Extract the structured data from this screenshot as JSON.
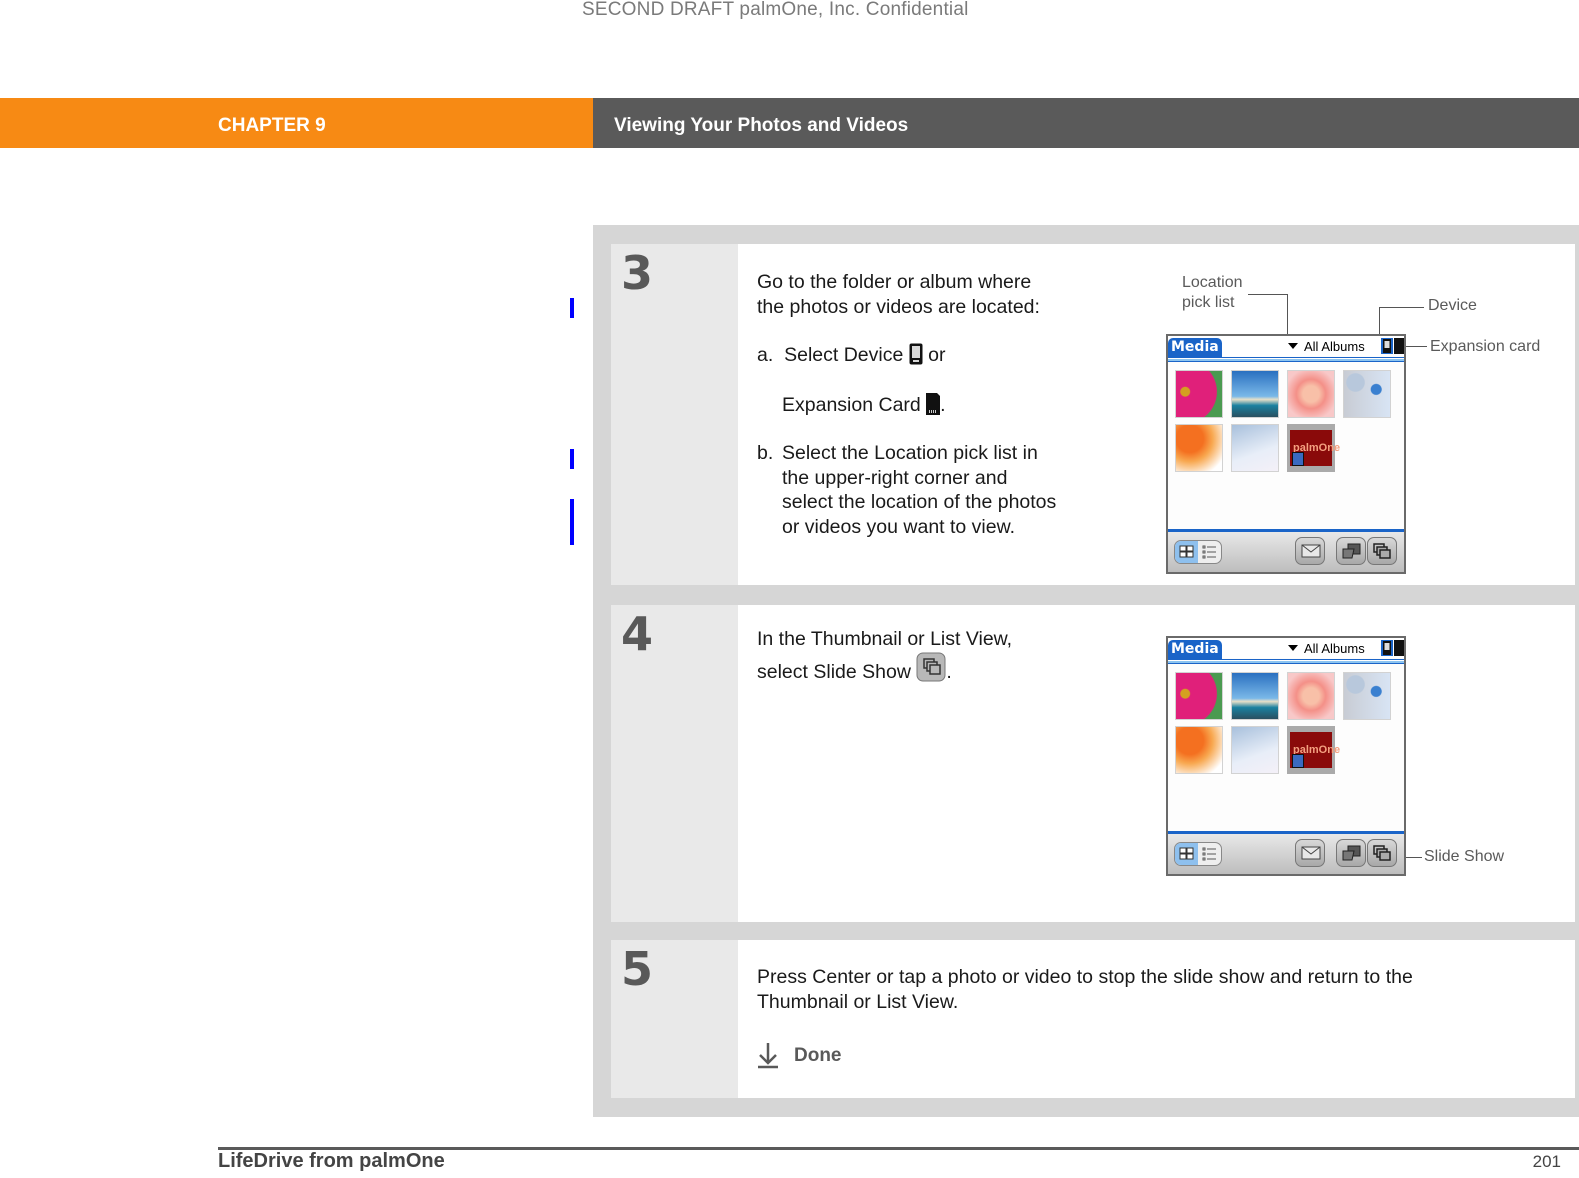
{
  "watermark": "SECOND DRAFT palmOne, Inc.  Confidential",
  "header": {
    "chapter_label": "CHAPTER 9",
    "chapter_title": "Viewing Your Photos and Videos",
    "colors": {
      "chapter_bg": "#f78a14",
      "title_bg": "#5a5a5a"
    }
  },
  "change_bar_color": "#0000ff",
  "steps": [
    {
      "number": "3",
      "intro_line1": "Go to the folder or album where",
      "intro_line2": "the photos or videos are located:",
      "item_a_label": "a.",
      "item_a_text1": "Select Device",
      "item_a_or": "or",
      "item_a_text2": "Expansion Card",
      "item_a_end": ".",
      "item_b_label": "b.",
      "item_b_lines": [
        "Select the Location pick list in",
        "the upper-right corner and",
        "select the location of the photos",
        "or videos you want to view."
      ],
      "callouts": {
        "location_line1": "Location",
        "location_line2": "pick list",
        "device": "Device",
        "expansion": "Expansion card"
      }
    },
    {
      "number": "4",
      "line1": "In the Thumbnail or List View,",
      "line2": "select Slide Show",
      "line2_end": ".",
      "callouts": {
        "slideshow": "Slide Show"
      }
    },
    {
      "number": "5",
      "line1": "Press Center or tap a photo or video to stop the slide show and return to the",
      "line2": "Thumbnail or List View.",
      "done_label": "Done"
    }
  ],
  "palm_screen": {
    "app_tab": "Media",
    "picklist_value": "All Albums",
    "thumbnails": [
      "pink-daisy",
      "palm-trees-beach",
      "pink-rose",
      "blue-bubbles",
      "orange-dots",
      "blue-swirl",
      "palmone-video"
    ],
    "video_logo": "palmOne"
  },
  "footer": {
    "book_title": "LifeDrive from palmOne",
    "page_number": "201"
  }
}
